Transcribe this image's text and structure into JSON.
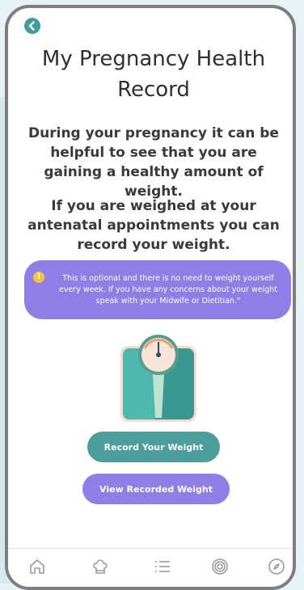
{
  "header": {
    "back_icon": "chevron-left-icon",
    "title": "My Pregnancy Health Record"
  },
  "intro": {
    "paragraph_1": "During your pregnancy it can be helpful to see that you are gaining a healthy amount of weight.",
    "paragraph_2": "If you are weighed at your antenatal appointments you can record your weight."
  },
  "notice": {
    "icon": "info-icon",
    "icon_glyph": "i",
    "text": "This is optional and there is no need to weight yourself every week. If you have any concerns about your weight speak with your Midwife or Dietitian.\""
  },
  "illustration": {
    "icon": "weighing-scale-icon"
  },
  "actions": {
    "record_label": "Record Your Weight",
    "view_label": "View Recorded Weight"
  },
  "bottom_nav": {
    "items": [
      {
        "icon": "home-icon"
      },
      {
        "icon": "chef-hat-icon"
      },
      {
        "icon": "list-icon"
      },
      {
        "icon": "target-icon"
      },
      {
        "icon": "compass-icon"
      }
    ]
  },
  "colors": {
    "teal": "#4b9e9c",
    "purple": "#8f7ee6",
    "info_yellow": "#f0c441",
    "text_dark": "#3a3a3a"
  }
}
